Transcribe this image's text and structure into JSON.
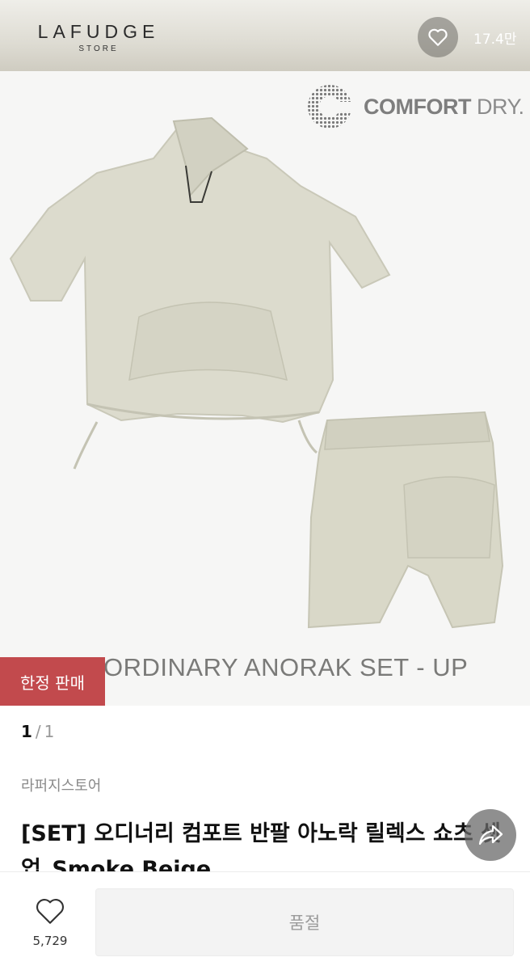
{
  "brand": {
    "name": "LAFUDGE",
    "sub": "STORE"
  },
  "wishlist": {
    "count_top": "17.4만",
    "count_bottom": "5,729"
  },
  "image": {
    "badge": "COMFORT DRY.",
    "badge_bold": "COMFORT",
    "badge_light": "DRY.",
    "caption": "ORDINARY ANORAK SET - UP",
    "limited_label": "한정 판매"
  },
  "pager": {
    "current": "1",
    "separator": "/",
    "total": "1"
  },
  "product": {
    "brand_kr": "라퍼지스토어",
    "title": "[SET] 오디너리 컴포트 반팔 아노락 릴렉스 쇼츠 셋업_Smoke Beige"
  },
  "actions": {
    "soldout_label": "품절"
  },
  "colors": {
    "limited_badge": "#c24a4d",
    "garment": "#d9d8c9"
  },
  "icons": [
    "heart-icon",
    "share-icon",
    "comfort-dry-logo"
  ]
}
